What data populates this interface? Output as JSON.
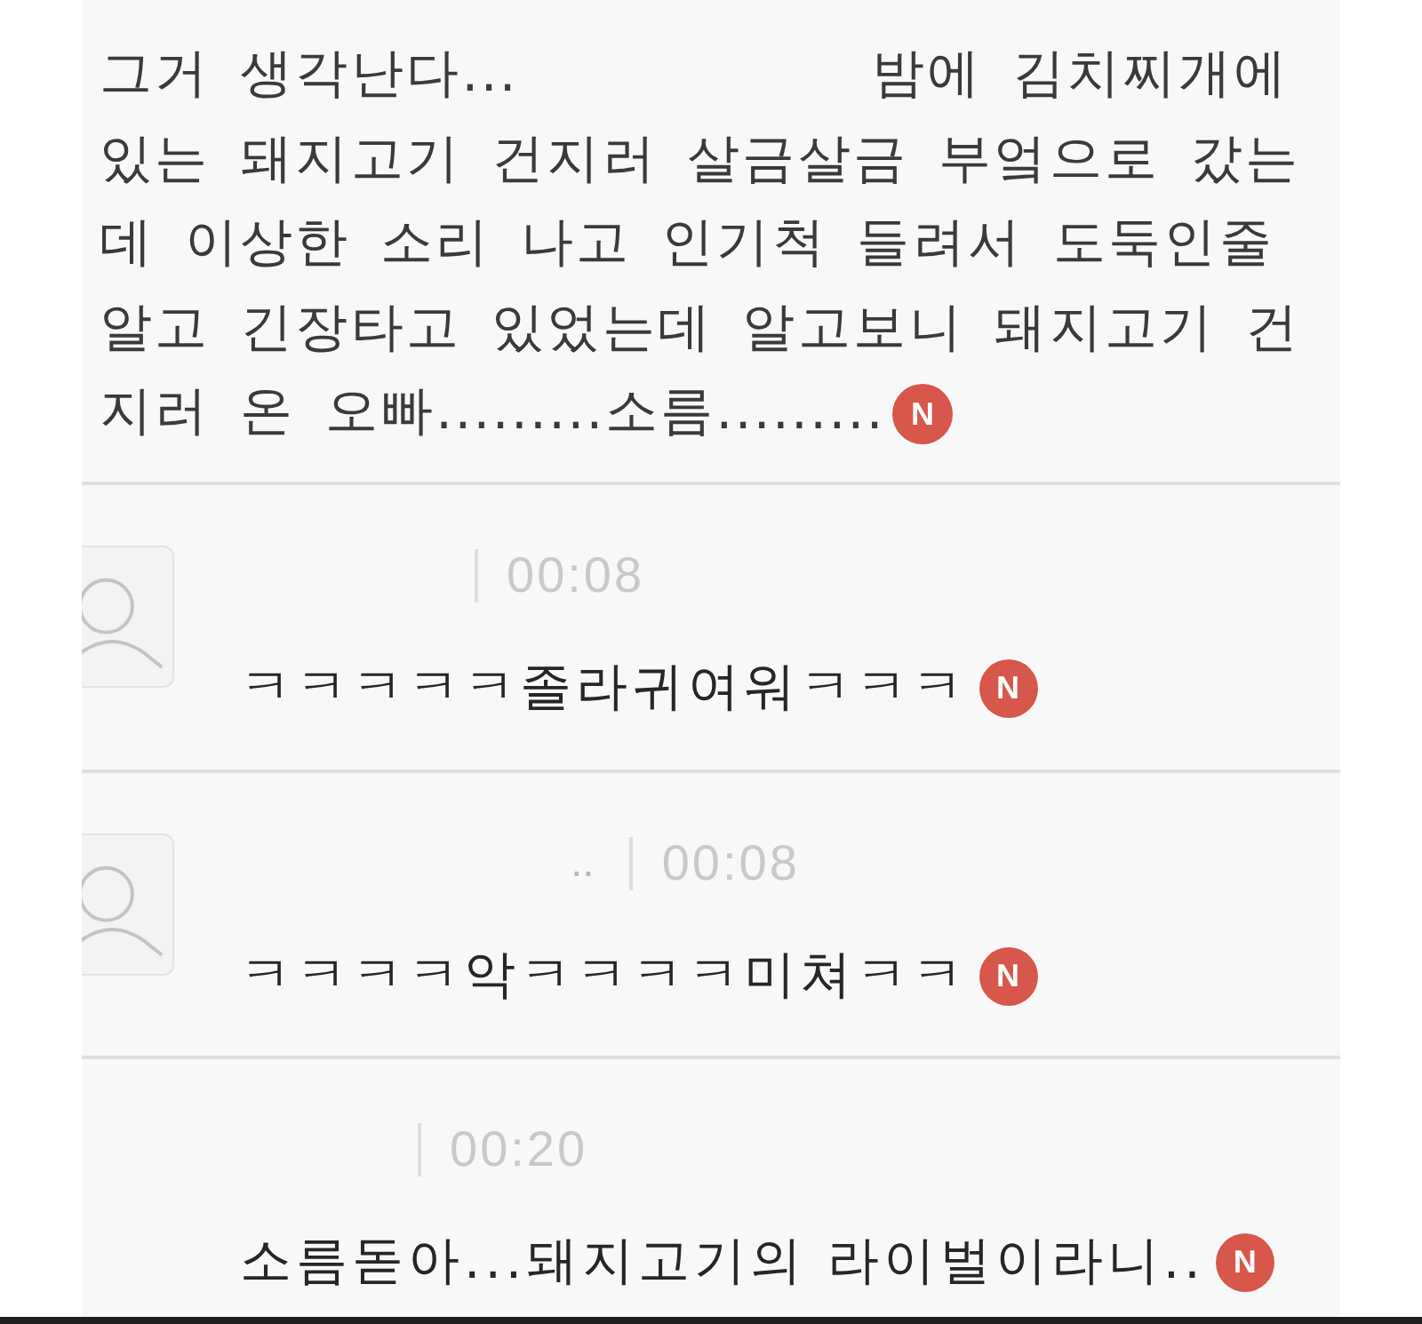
{
  "post": {
    "text": "그거 생각난다...            밤에 김치찌개에 있는 돼지고기 건지러 살금살금 부엌으로 갔는데 이상한 소리 나고 인기척 들려서 도둑인줄 알고 긴장타고 있었는데 알고보니 돼지고기 건지러 온 오빠.........소름.........",
    "badge": "N"
  },
  "comments": [
    {
      "avatar": true,
      "time": "00:08",
      "text": "ㅋㅋㅋㅋㅋ졸라귀여워ㅋㅋㅋ",
      "badge": "N"
    },
    {
      "avatar": true,
      "author": "..",
      "time": "00:08",
      "text": "ㅋㅋㅋㅋ악ㅋㅋㅋㅋ미쳐ㅋㅋ",
      "badge": "N"
    },
    {
      "avatar": false,
      "time": "00:20",
      "text": "소름돋아...돼지고기의 라이벌이라니..",
      "badge": "N"
    }
  ]
}
